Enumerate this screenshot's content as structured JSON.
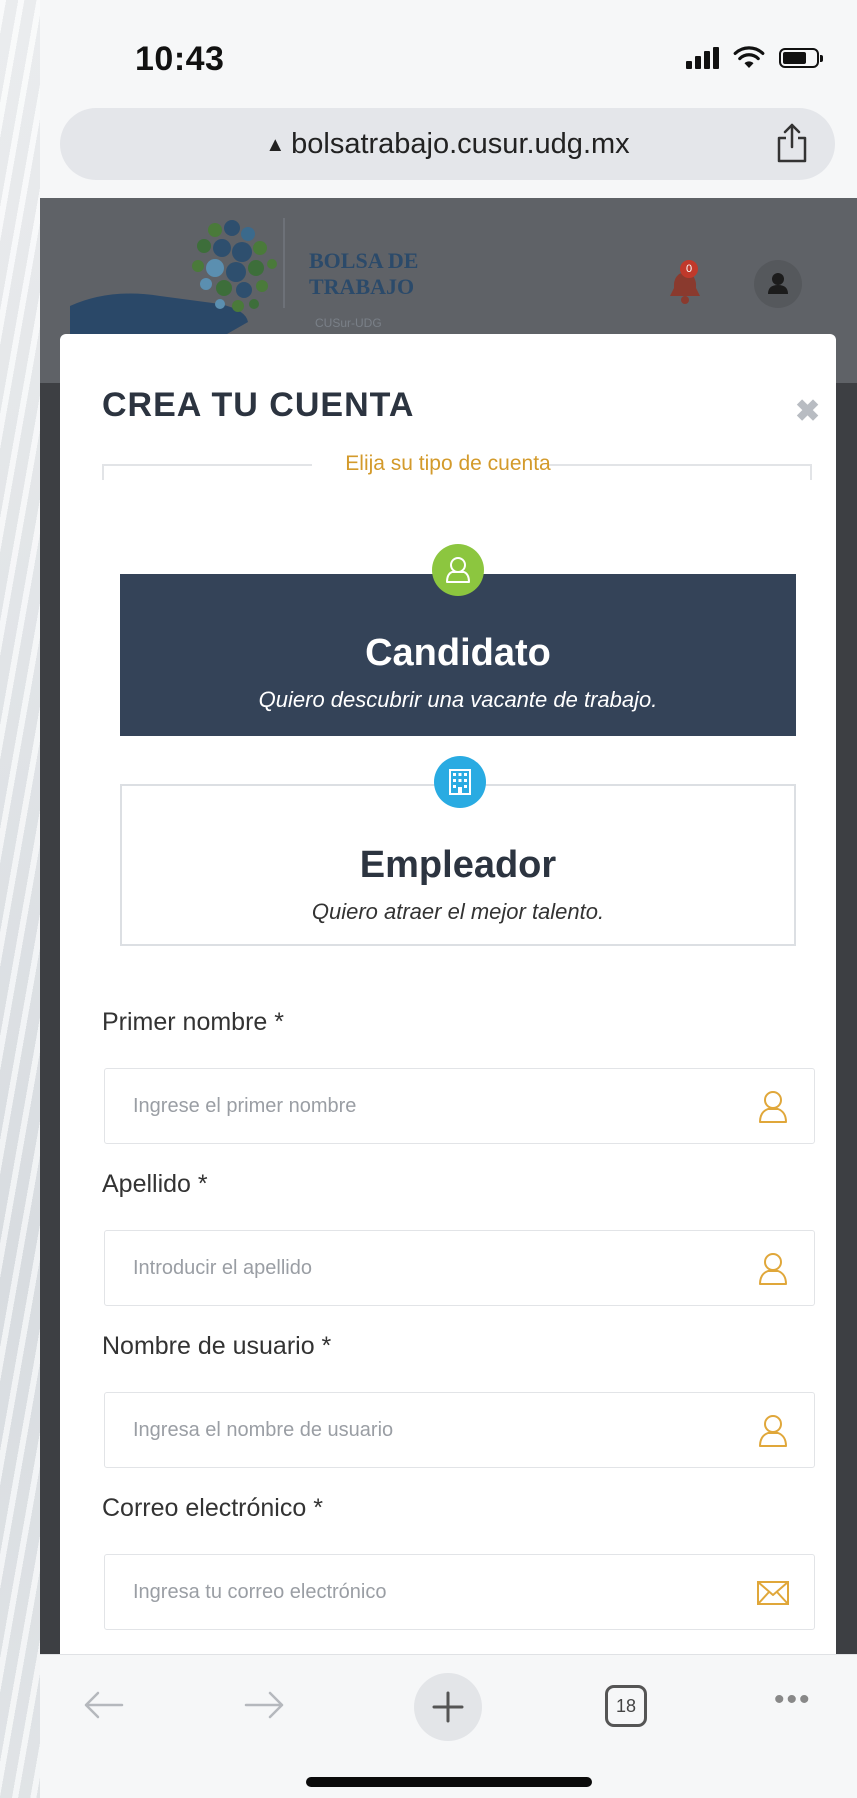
{
  "status_bar": {
    "time": "10:43",
    "battery_level": 0.75
  },
  "browser": {
    "url": "bolsatrabajo.cusur.udg.mx",
    "tabs_count": "18"
  },
  "site_header": {
    "logo_title_line1": "BOLSA DE",
    "logo_title_line2": "TRABAJO",
    "logo_subtitle": "CUSur-UDG",
    "notification_count": "0"
  },
  "modal": {
    "title": "CREA TU CUENTA",
    "account_type_legend": "Elija su tipo de cuenta",
    "account_types": [
      {
        "title": "Candidato",
        "description": "Quiero descubrir una vacante de trabajo.",
        "selected": true
      },
      {
        "title": "Empleador",
        "description": "Quiero atraer el mejor talento.",
        "selected": false
      }
    ],
    "fields": [
      {
        "label": "Primer nombre *",
        "placeholder": "Ingrese el primer nombre",
        "value": "",
        "icon": "user-outline-icon"
      },
      {
        "label": "Apellido *",
        "placeholder": "Introducir el apellido",
        "value": "",
        "icon": "user-outline-icon"
      },
      {
        "label": "Nombre de usuario *",
        "placeholder": "Ingresa el nombre de usuario",
        "value": "",
        "icon": "user-outline-icon"
      },
      {
        "label": "Correo electrónico *",
        "placeholder": "Ingresa tu correo electrónico",
        "value": "",
        "icon": "envelope-icon"
      }
    ]
  },
  "colors": {
    "candidato_card": "#344358",
    "candidato_badge": "#8cc63f",
    "empleador_badge": "#29abe2",
    "legend_accent": "#d39a2b",
    "field_icon_accent": "#e0a73a"
  }
}
